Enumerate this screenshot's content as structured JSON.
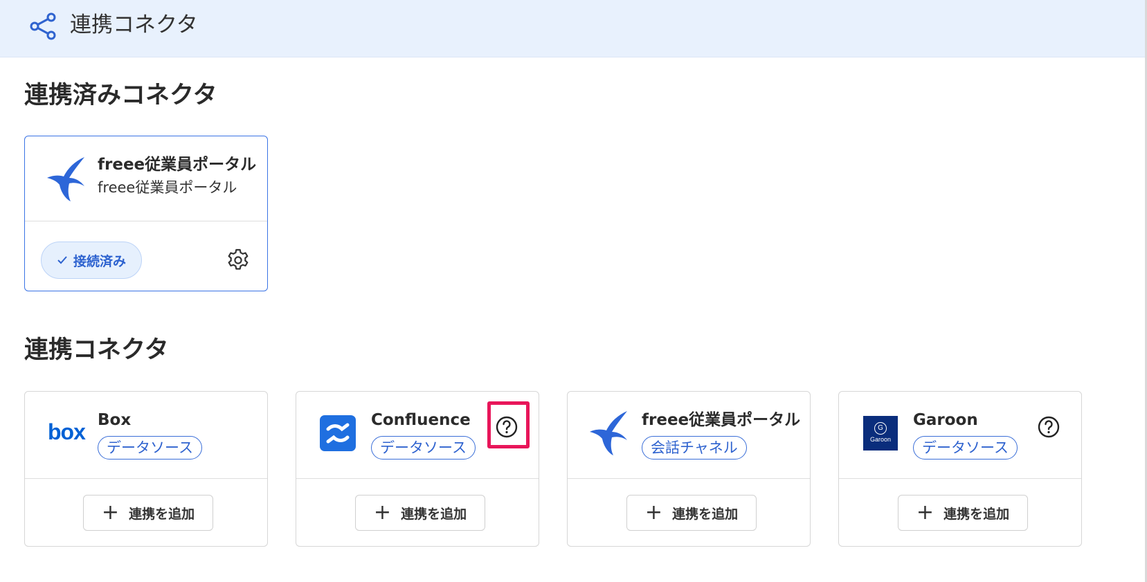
{
  "header": {
    "title": "連携コネクタ",
    "icon": "share-icon"
  },
  "connected_section": {
    "heading": "連携済みコネクタ",
    "cards": [
      {
        "name": "freee従業員ポータル",
        "subtitle": "freee従業員ポータル",
        "status": "接続済み",
        "logo": "freee-bird-logo"
      }
    ]
  },
  "connectors_section": {
    "heading": "連携コネクタ",
    "add_label": "連携を追加",
    "cards": [
      {
        "name": "Box",
        "tag": "データソース",
        "logo": "box-logo",
        "logo_text": "box",
        "help": false
      },
      {
        "name": "Confluence",
        "tag": "データソース",
        "logo": "confluence-logo",
        "help": true,
        "help_highlighted": true
      },
      {
        "name": "freee従業員ポータル",
        "tag": "会話チャネル",
        "logo": "freee-bird-logo",
        "help": false
      },
      {
        "name": "Garoon",
        "tag": "データソース",
        "logo": "garoon-logo",
        "logo_text": "Garoon",
        "logo_letter": "G",
        "help": true
      }
    ]
  },
  "colors": {
    "header_bg": "#e8f1fd",
    "accent_blue": "#3a6ed8",
    "highlight": "#e8165a",
    "box_blue": "#0061d5",
    "confluence_blue": "#1f6fe0",
    "garoon_navy": "#0a2d7c"
  }
}
